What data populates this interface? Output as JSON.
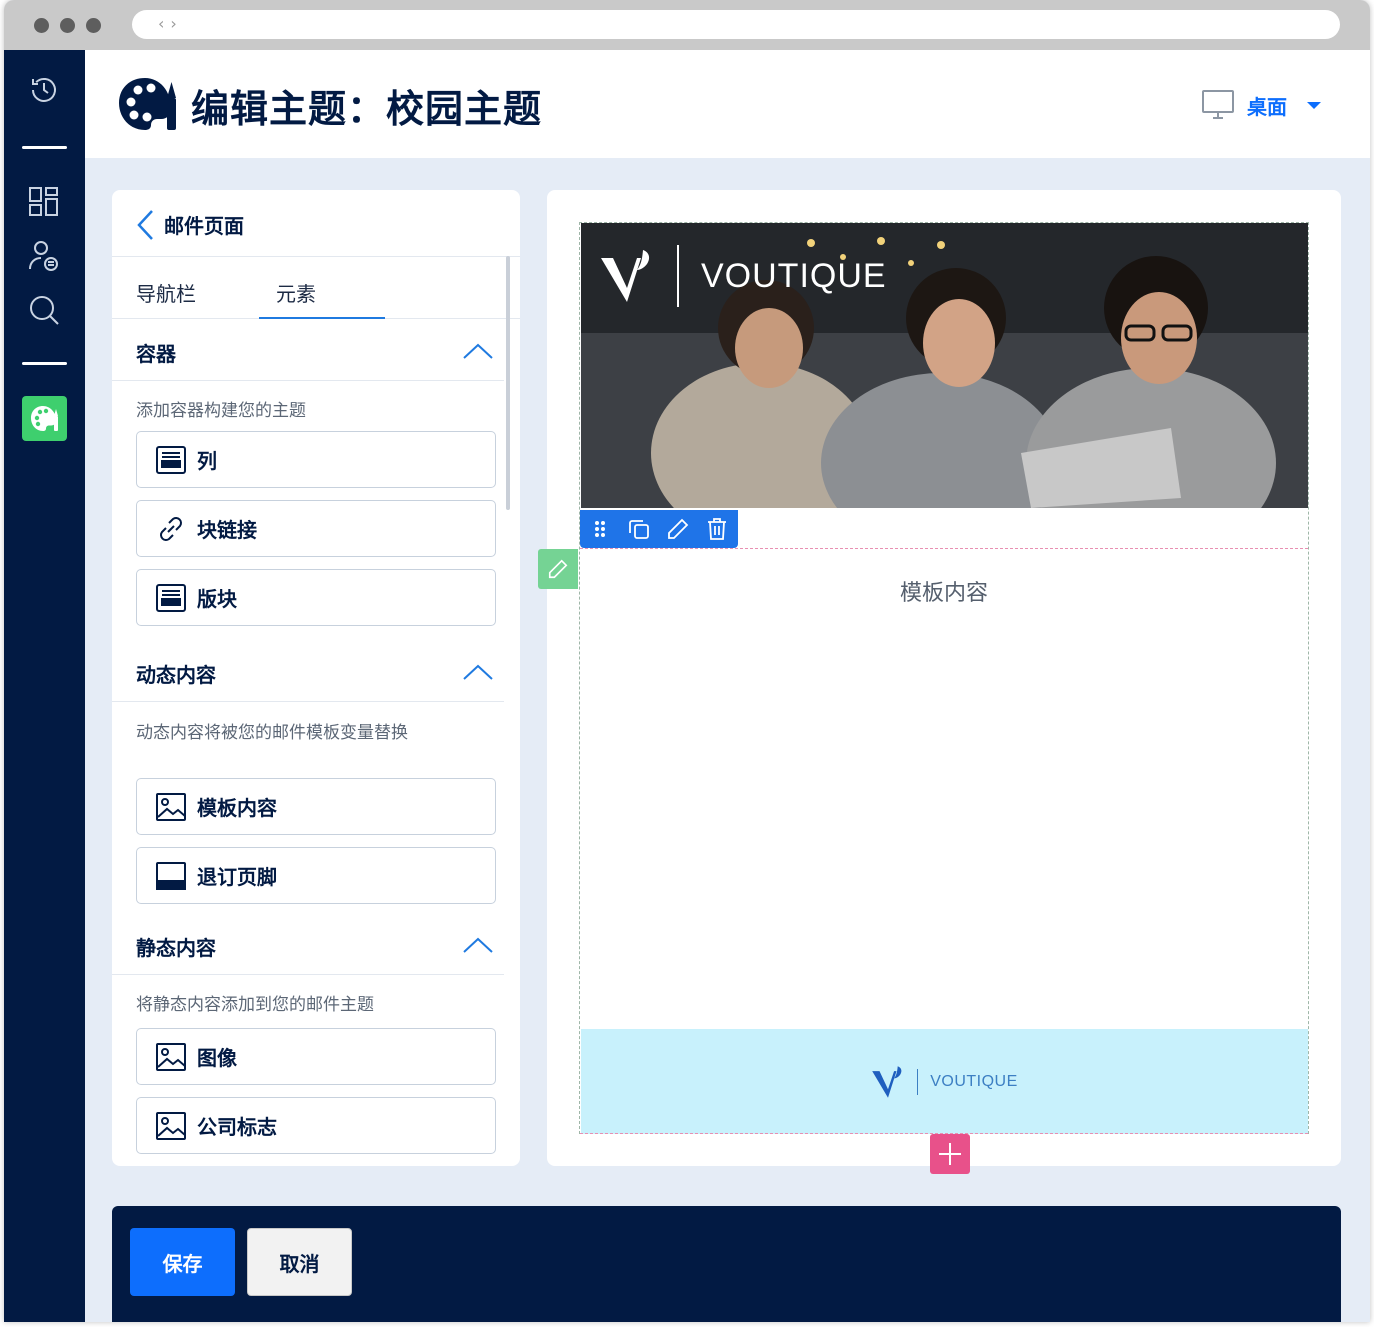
{
  "header": {
    "title": "编辑主题：校园主题",
    "device_label": "桌面"
  },
  "panel": {
    "title": "邮件页面",
    "tabs": [
      {
        "label": "导航栏"
      },
      {
        "label": "元素"
      }
    ],
    "sections": [
      {
        "title": "容器",
        "description": "添加容器构建您的主题",
        "items": [
          {
            "label": "列",
            "icon": "columns-icon"
          },
          {
            "label": "块链接",
            "icon": "link-icon"
          },
          {
            "label": "版块",
            "icon": "section-icon"
          }
        ]
      },
      {
        "title": "动态内容",
        "description": "动态内容将被您的邮件模板变量替换",
        "items": [
          {
            "label": "模板内容",
            "icon": "image-icon"
          },
          {
            "label": "退订页脚",
            "icon": "footer-icon"
          }
        ]
      },
      {
        "title": "静态内容",
        "description": "将静态内容添加到您的邮件主题",
        "items": [
          {
            "label": "图像",
            "icon": "image-icon"
          },
          {
            "label": "公司标志",
            "icon": "image-icon"
          }
        ]
      }
    ]
  },
  "canvas": {
    "hero_brand": "VOUTIQUE",
    "template_content": "模板内容",
    "footer_brand": "VOUTIQUE"
  },
  "actions": {
    "save_label": "保存",
    "cancel_label": "取消"
  },
  "colors": {
    "navy": "#021a43",
    "primary": "#0d6efd",
    "green": "#3ecf6e",
    "pink": "#e8518a",
    "footer_band": "#c8f1fc"
  }
}
